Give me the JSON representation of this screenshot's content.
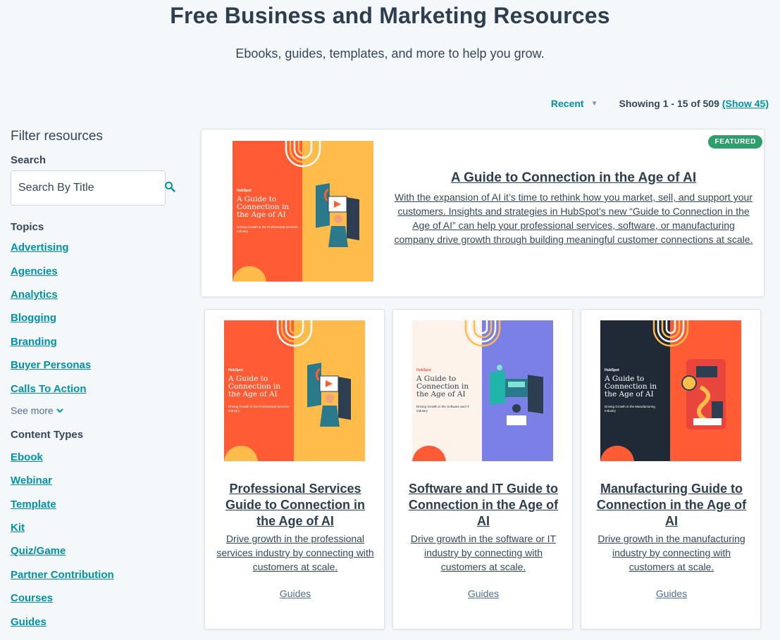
{
  "header": {
    "title": "Free Business and Marketing Resources",
    "subtitle": "Ebooks, guides, templates, and more to help you grow."
  },
  "sort": {
    "selected": "Recent",
    "showing": "Showing 1 - 15 of 509",
    "show_more": "(Show 45)"
  },
  "sidebar": {
    "title": "Filter resources",
    "search_label": "Search",
    "search_placeholder": "Search By Title",
    "topics_label": "Topics",
    "topics": [
      "Advertising",
      "Agencies",
      "Analytics",
      "Blogging",
      "Branding",
      "Buyer Personas",
      "Calls To Action"
    ],
    "see_more": "See more",
    "content_types_label": "Content Types",
    "content_types": [
      "Ebook",
      "Webinar",
      "Template",
      "Kit",
      "Quiz/Game",
      "Partner Contribution",
      "Courses",
      "Guides"
    ]
  },
  "featured": {
    "badge": "FEATURED",
    "title": "A Guide to Connection in the Age of AI",
    "description": "With the expansion of AI it’s time to rethink how you market, sell, and support your customers. Insights and strategies in HubSpot’s new “Guide to Connection in the Age of AI” can help your professional services, software, or manufacturing company drive growth through building meaningful customer connections at scale.",
    "cover": {
      "logo": "HubSpot",
      "title": "A Guide to Connection in the Age of AI",
      "subtitle": "Driving Growth in the Professional Services Industry",
      "left_color": "#ff5c35",
      "right_color": "#ffbc4b"
    }
  },
  "cards": [
    {
      "title": "Professional Services Guide to Connection in the Age of AI",
      "description": "Drive growth in the professional services industry by connecting with customers at scale.",
      "tag": "Guides",
      "cover": {
        "logo": "HubSpot",
        "title": "A Guide to Connection in the Age of AI",
        "subtitle": "Driving Growth in the Professional Services Industry",
        "left_color": "#ff5c35",
        "right_color": "#ffbc4b"
      }
    },
    {
      "title": "Software and IT Guide to Connection in the Age of AI",
      "description": "Drive growth in the software or IT industry by connecting with customers at scale.",
      "tag": "Guides",
      "cover": {
        "logo": "HubSpot",
        "title": "A Guide to Connection in the Age of AI",
        "subtitle": "Driving Growth in the Software and IT Industry",
        "left_color": "#fdf3ea",
        "right_color": "#7b80e6"
      }
    },
    {
      "title": "Manufacturing Guide to Connection in the Age of AI",
      "description": "Drive growth in the manufacturing industry by connecting with customers at scale.",
      "tag": "Guides",
      "cover": {
        "logo": "HubSpot",
        "title": "A Guide to Connection in the Age of AI",
        "subtitle": "Driving Growth in the Manufacturing Industry",
        "left_color": "#1f2a36",
        "right_color": "#ff5c35"
      }
    }
  ],
  "colors": {
    "link": "#0091ae",
    "heading": "#2d3e50",
    "featured_badge": "#2e9e6a",
    "accent_orange": "#ff5c35",
    "accent_yellow": "#ffbc4b"
  }
}
